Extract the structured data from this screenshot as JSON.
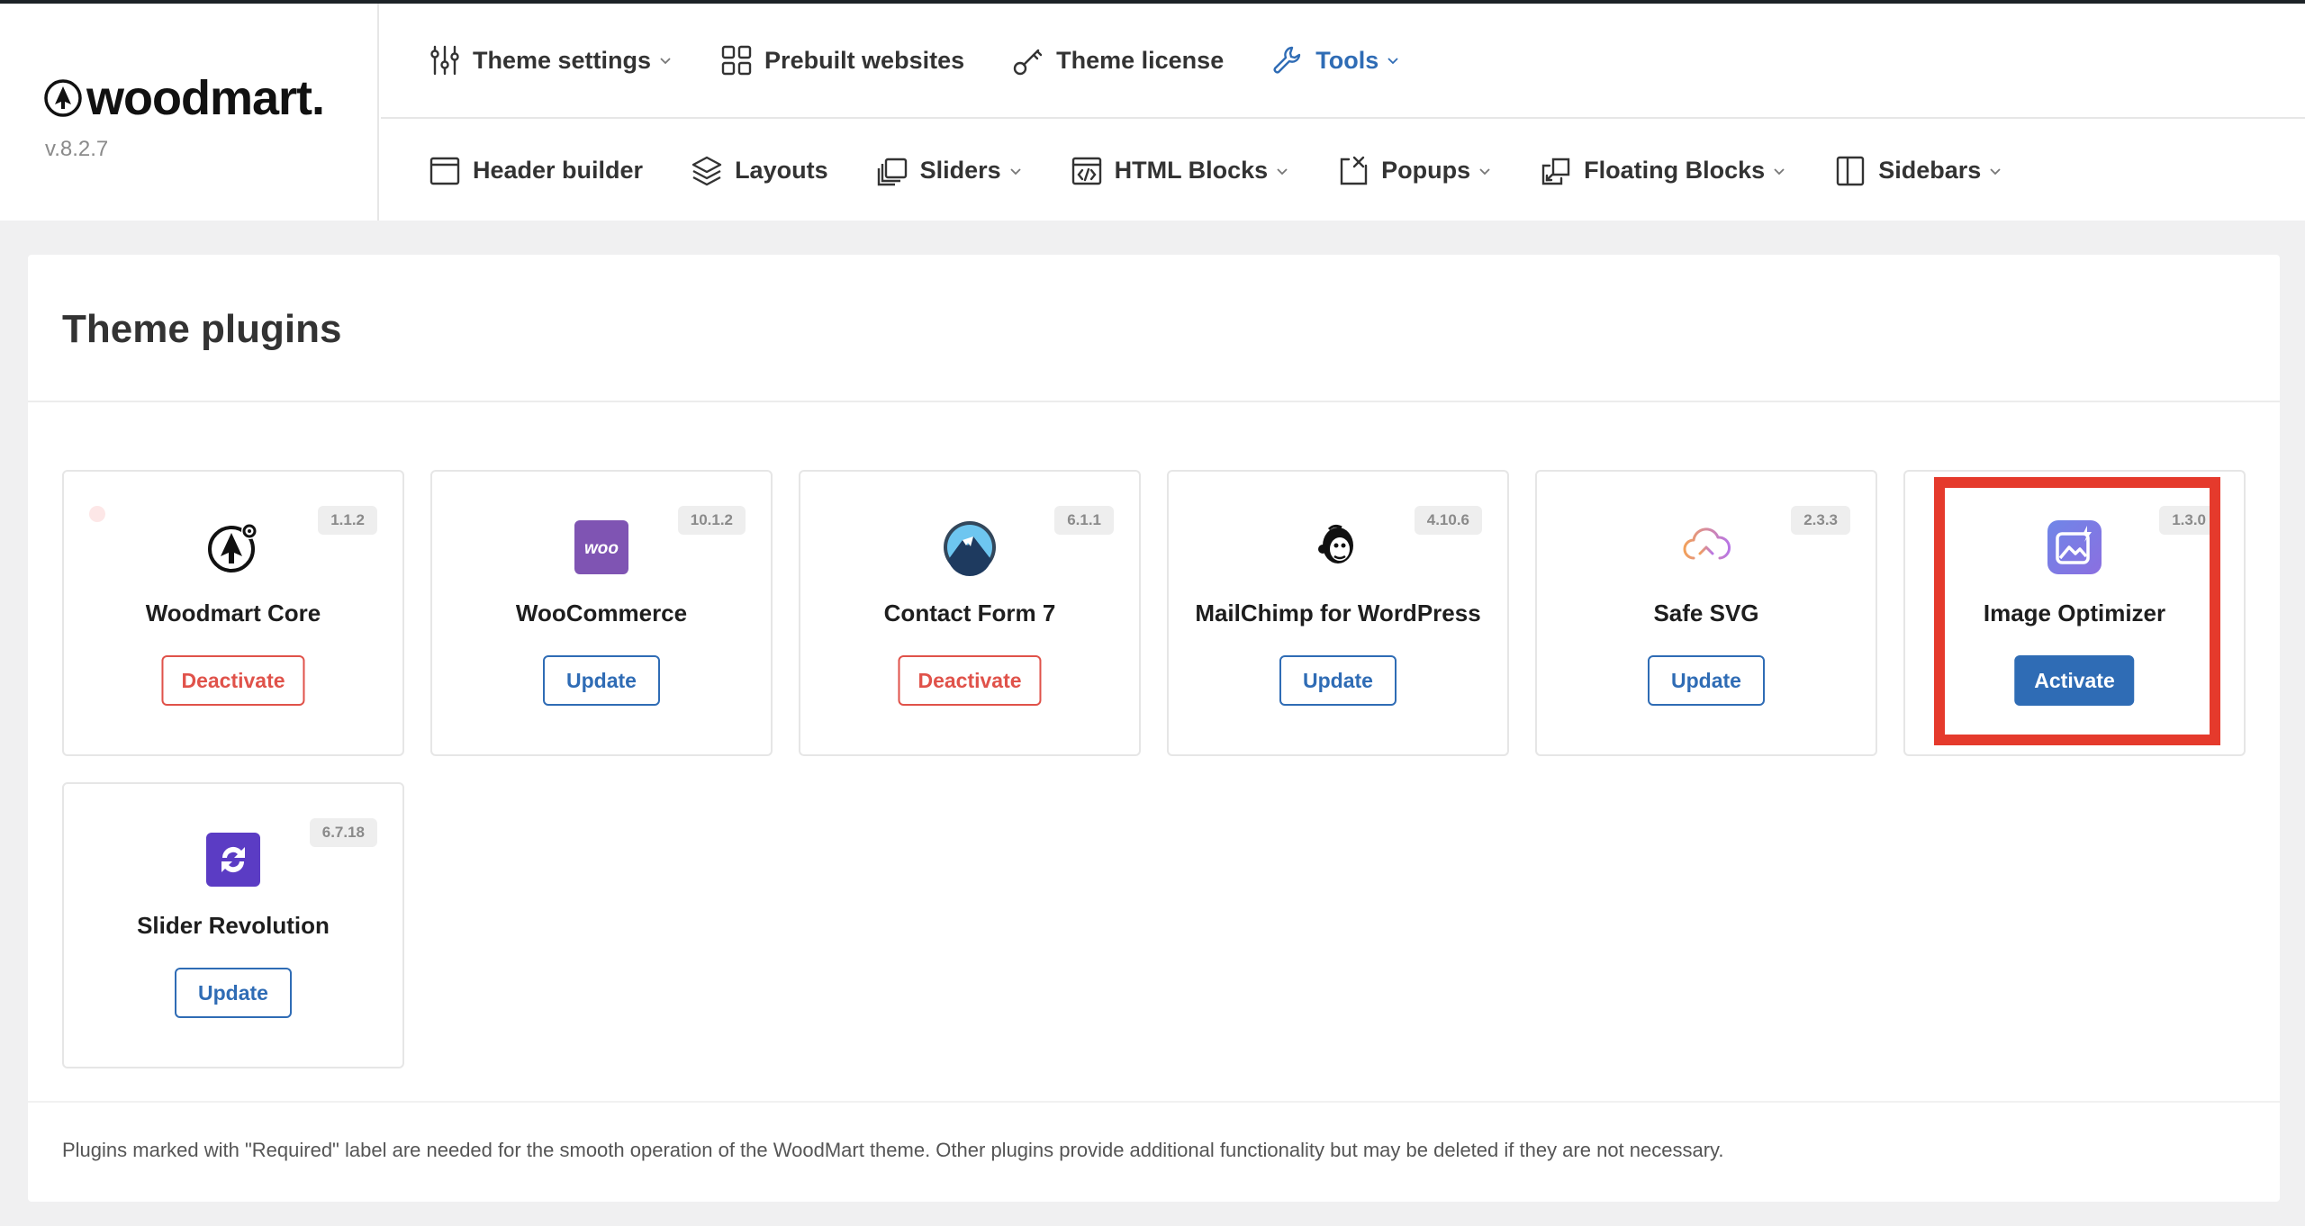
{
  "brand": {
    "name": "woodmart.",
    "version": "v.8.2.7"
  },
  "nav_primary": [
    {
      "label": "Theme settings",
      "icon": "sliders-icon",
      "has_dropdown": true,
      "active": false
    },
    {
      "label": "Prebuilt websites",
      "icon": "grid-icon",
      "has_dropdown": false,
      "active": false
    },
    {
      "label": "Theme license",
      "icon": "key-icon",
      "has_dropdown": false,
      "active": false
    },
    {
      "label": "Tools",
      "icon": "wrench-icon",
      "has_dropdown": true,
      "active": true
    }
  ],
  "nav_secondary": [
    {
      "label": "Header builder",
      "icon": "window-icon",
      "has_dropdown": false
    },
    {
      "label": "Layouts",
      "icon": "layers-icon",
      "has_dropdown": false
    },
    {
      "label": "Sliders",
      "icon": "slides-icon",
      "has_dropdown": true
    },
    {
      "label": "HTML Blocks",
      "icon": "code-window-icon",
      "has_dropdown": true
    },
    {
      "label": "Popups",
      "icon": "popup-icon",
      "has_dropdown": true
    },
    {
      "label": "Floating Blocks",
      "icon": "floating-block-icon",
      "has_dropdown": true
    },
    {
      "label": "Sidebars",
      "icon": "sidebar-icon",
      "has_dropdown": true
    }
  ],
  "panel": {
    "title": "Theme plugins",
    "note": "Plugins marked with \"Required\" label are needed for the smooth operation of the WoodMart theme. Other plugins provide additional functionality but may be deleted if they are not necessary."
  },
  "plugins": [
    {
      "name": "Woodmart Core",
      "version": "1.1.2",
      "action": "Deactivate",
      "action_type": "deactivate",
      "icon": "woodmart-core-icon"
    },
    {
      "name": "WooCommerce",
      "version": "10.1.2",
      "action": "Update",
      "action_type": "update",
      "icon": "woocommerce-icon",
      "icon_text": "woo"
    },
    {
      "name": "Contact Form 7",
      "version": "6.1.1",
      "action": "Deactivate",
      "action_type": "deactivate",
      "icon": "contact-form-icon"
    },
    {
      "name": "MailChimp for WordPress",
      "version": "4.10.6",
      "action": "Update",
      "action_type": "update",
      "icon": "mailchimp-icon"
    },
    {
      "name": "Safe SVG",
      "version": "2.3.3",
      "action": "Update",
      "action_type": "update",
      "icon": "cloud-upload-icon"
    },
    {
      "name": "Image Optimizer",
      "version": "1.3.0",
      "action": "Activate",
      "action_type": "activate",
      "icon": "image-optimizer-icon"
    },
    {
      "name": "Slider Revolution",
      "version": "6.7.18",
      "action": "Update",
      "action_type": "update",
      "icon": "slider-revolution-icon"
    }
  ],
  "colors": {
    "accent": "#2f6cb5",
    "danger": "#e0524a",
    "highlight": "#e53a2c",
    "woo": "#7f54b3",
    "slider_rev": "#5b3cc4"
  }
}
